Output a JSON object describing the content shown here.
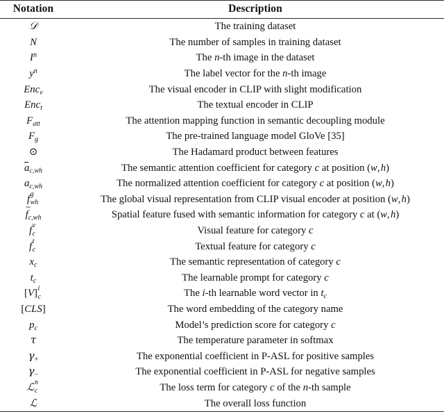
{
  "table": {
    "headers": {
      "notation": "Notation",
      "description": "Description"
    },
    "rows": [
      {
        "notation_plain": "D",
        "description": "The training dataset"
      },
      {
        "notation_plain": "N",
        "description": "The number of samples in training dataset"
      },
      {
        "notation_plain": "I^n",
        "description": "The n-th image in the dataset"
      },
      {
        "notation_plain": "y^n",
        "description": "The label vector for the n-th image"
      },
      {
        "notation_plain": "Enc_v",
        "description": "The visual encoder in CLIP with slight modification"
      },
      {
        "notation_plain": "Enc_t",
        "description": "The textual encoder in CLIP"
      },
      {
        "notation_plain": "F_att",
        "description": "The attention mapping function in semantic decoupling module"
      },
      {
        "notation_plain": "F_g",
        "description": "The pre-trained language model GloVe [35]"
      },
      {
        "notation_plain": "⊙",
        "description": "The Hadamard product between features"
      },
      {
        "notation_plain": "ā_c,wh",
        "description": "The semantic attention coefficient for category c at position (w, h)"
      },
      {
        "notation_plain": "a_c,wh",
        "description": "The normalized attention coefficient for category c at position (w, h)"
      },
      {
        "notation_plain": "f^g_wh",
        "description": "The global visual representation from CLIP visual encoder at position (w, h)"
      },
      {
        "notation_plain": "f̃_c,wh",
        "description": "Spatial feature fused with semantic information for category c at (w, h)"
      },
      {
        "notation_plain": "f^v_c",
        "description": "Visual feature for category c"
      },
      {
        "notation_plain": "f^t_c",
        "description": "Textual feature for category c"
      },
      {
        "notation_plain": "x_c",
        "description": "The semantic representation of category c"
      },
      {
        "notation_plain": "t_c",
        "description": "The learnable prompt for category c"
      },
      {
        "notation_plain": "[V]^i_c",
        "description": "The i-th learnable word vector in t_c"
      },
      {
        "notation_plain": "[CLS]",
        "description": "The word embedding of the category name"
      },
      {
        "notation_plain": "p_c",
        "description": "Model's prediction score for category c"
      },
      {
        "notation_plain": "τ",
        "description": "The temperature parameter in softmax"
      },
      {
        "notation_plain": "γ+",
        "description": "The exponential coefficient in P-ASL for positive samples"
      },
      {
        "notation_plain": "γ−",
        "description": "The exponential coefficient in P-ASL for negative samples"
      },
      {
        "notation_plain": "L^n_c",
        "description": "The loss term for category c of the n-th sample"
      },
      {
        "notation_plain": "L",
        "description": "The overall loss function"
      }
    ],
    "citation": "[35]",
    "rule_color": "#2b2b2b"
  }
}
